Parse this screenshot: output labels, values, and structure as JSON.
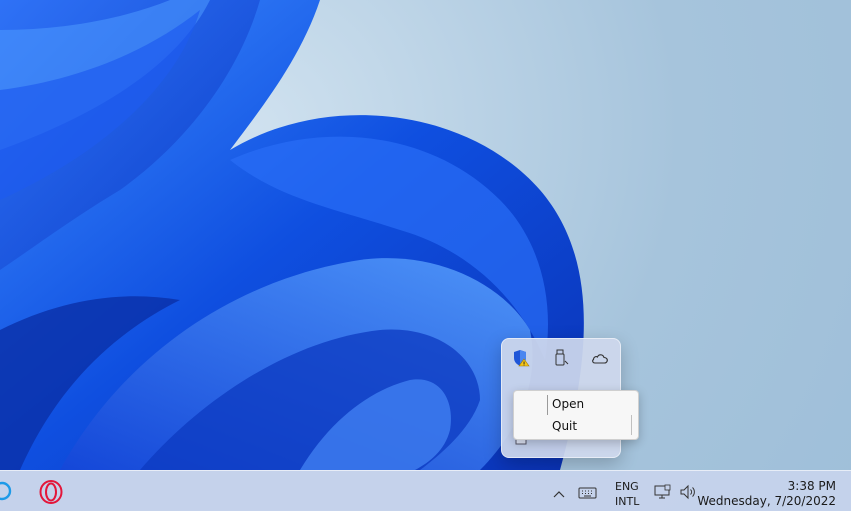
{
  "tray_flyout": {
    "icons": [
      "security-warning-icon",
      "usb-drive-icon",
      "onedrive-cloud-icon"
    ]
  },
  "context_menu": {
    "items": [
      {
        "label": "Open"
      },
      {
        "label": "Quit"
      }
    ]
  },
  "taskbar": {
    "language_line1": "ENG",
    "language_line2": "INTL",
    "clock_time": "3:38 PM",
    "clock_date": "Wednesday, 7/20/2022",
    "icons": [
      "cortana-icon",
      "opera-icon",
      "show-hidden-icons-chevron",
      "touch-keyboard-icon",
      "network-icon",
      "volume-icon"
    ]
  },
  "colors": {
    "accent": "#1a5be8",
    "taskbar_bg": "#c6d2eb"
  }
}
